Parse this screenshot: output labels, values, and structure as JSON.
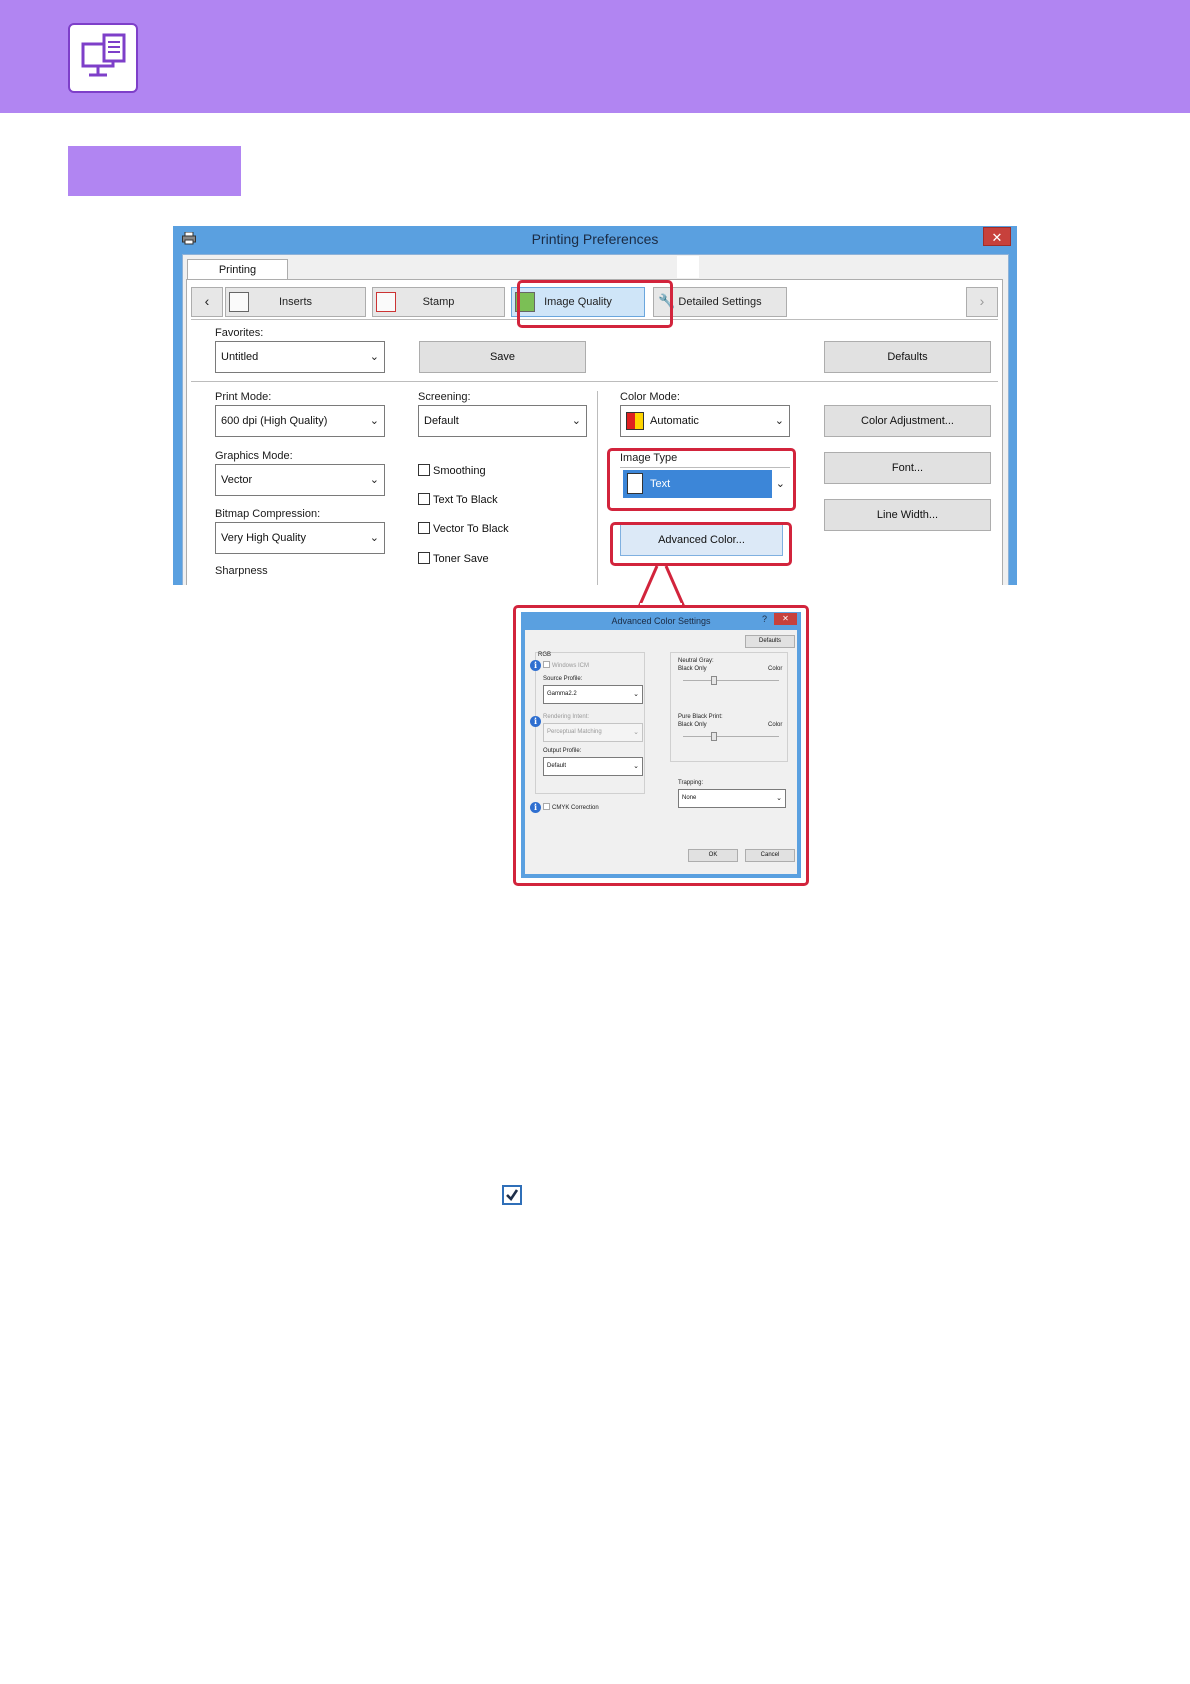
{
  "header": {
    "icon": "computer-printer-icon",
    "color": "#b185f2"
  },
  "section_tab": {
    "color": "#b185f2"
  },
  "dialog": {
    "title": "Printing Preferences",
    "close_glyph": "✕",
    "outer_tab": "Printing Preferences",
    "nav": {
      "prev": "‹",
      "next": "›",
      "inserts": "Inserts",
      "stamp": "Stamp",
      "image_quality": "Image Quality",
      "detailed_settings": "Detailed Settings"
    },
    "favorites": {
      "label": "Favorites:",
      "value": "Untitled"
    },
    "save": "Save",
    "defaults": "Defaults",
    "print_mode": {
      "label": "Print Mode:",
      "value": "600 dpi (High Quality)"
    },
    "screening": {
      "label": "Screening:",
      "value": "Default"
    },
    "color_mode": {
      "label": "Color Mode:",
      "value": "Automatic"
    },
    "color_adjustment": "Color Adjustment...",
    "graphics_mode": {
      "label": "Graphics Mode:",
      "value": "Vector"
    },
    "smoothing": "Smoothing",
    "image_type": {
      "label": "Image Type",
      "value": "Text"
    },
    "font": "Font...",
    "text_to_black": "Text To Black",
    "vector_to_black": "Vector To Black",
    "bitmap_compression": {
      "label": "Bitmap Compression:",
      "value": "Very High Quality"
    },
    "line_width": "Line Width...",
    "advanced_color": "Advanced Color...",
    "toner_save": "Toner Save",
    "sharpness": "Sharpness",
    "highlight_color": "#d2243c"
  },
  "advanced_dialog": {
    "title": "Advanced Color Settings",
    "help": "?",
    "close_glyph": "✕",
    "defaults": "Defaults",
    "rgb": "RGB",
    "windows_icm": "Windows ICM",
    "source_profile": {
      "label": "Source Profile:",
      "value": "Gamma2.2"
    },
    "rendering_intent": {
      "label": "Rendering Intent:",
      "value": "Perceptual Matching"
    },
    "output_profile": {
      "label": "Output Profile:",
      "value": "Default"
    },
    "cmyk_correction": "CMYK Correction",
    "neutral_gray": {
      "label": "Neutral Gray:",
      "left": "Black Only",
      "right": "Color"
    },
    "pure_black_print": {
      "label": "Pure Black Print:",
      "left": "Black Only",
      "right": "Color"
    },
    "trapping": {
      "label": "Trapping:",
      "value": "None"
    },
    "ok": "OK",
    "cancel": "Cancel"
  },
  "checkbox_glyph": "✔"
}
